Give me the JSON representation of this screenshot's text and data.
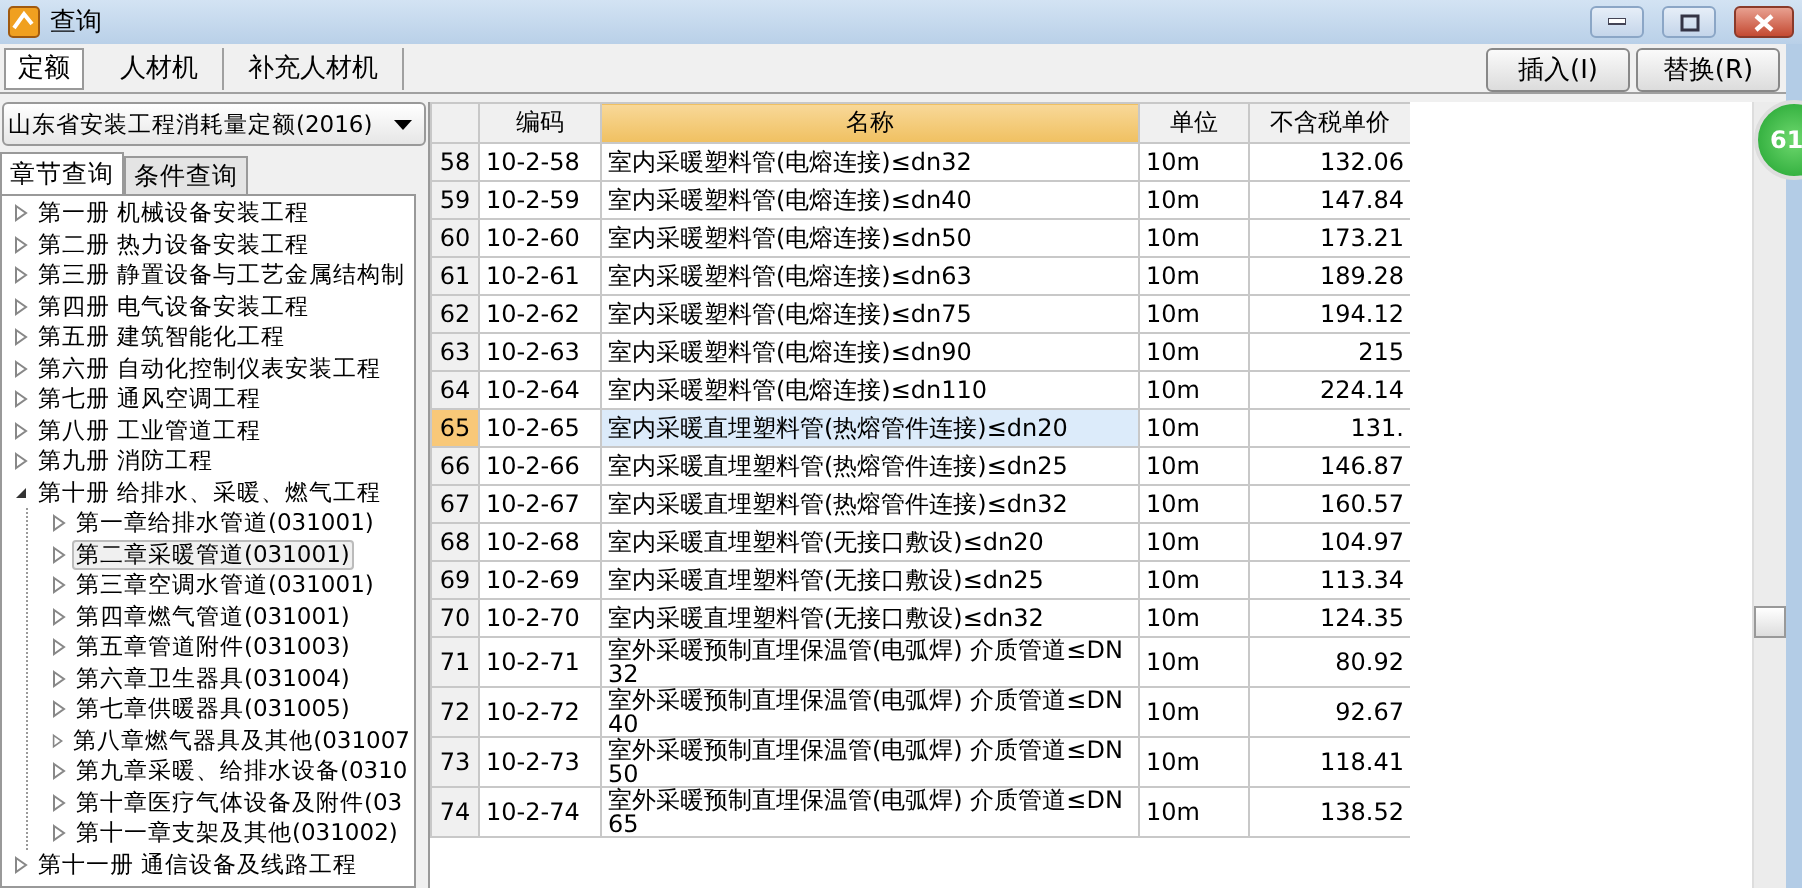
{
  "window": {
    "title": "查询"
  },
  "tabs": [
    {
      "label": "定额",
      "selected": true
    },
    {
      "label": "人材机",
      "selected": false
    },
    {
      "label": "补充人材机",
      "selected": false
    }
  ],
  "buttons": [
    "插入(I)",
    "替换(R)"
  ],
  "library_select": {
    "value": "山东省安装工程消耗量定额(2016)"
  },
  "search_tabs": [
    {
      "label": "章节查询",
      "selected": true
    },
    {
      "label": "条件查询",
      "selected": false
    }
  ],
  "tree": [
    {
      "label": "第一册 机械设备安装工程",
      "expanded": false,
      "selected": false
    },
    {
      "label": "第二册 热力设备安装工程",
      "expanded": false,
      "selected": false
    },
    {
      "label": "第三册 静置设备与工艺金属结构制",
      "expanded": false,
      "selected": false
    },
    {
      "label": "第四册 电气设备安装工程",
      "expanded": false,
      "selected": false
    },
    {
      "label": "第五册 建筑智能化工程",
      "expanded": false,
      "selected": false
    },
    {
      "label": "第六册 自动化控制仪表安装工程",
      "expanded": false,
      "selected": false
    },
    {
      "label": "第七册 通风空调工程",
      "expanded": false,
      "selected": false
    },
    {
      "label": "第八册 工业管道工程",
      "expanded": false,
      "selected": false
    },
    {
      "label": "第九册 消防工程",
      "expanded": false,
      "selected": false
    },
    {
      "label": "第十册 给排水、采暖、燃气工程",
      "expanded": true,
      "selected": false,
      "children": [
        {
          "label": "第一章给排水管道(031001)",
          "expanded": false,
          "selected": false
        },
        {
          "label": "第二章采暖管道(031001)",
          "expanded": false,
          "selected": true
        },
        {
          "label": "第三章空调水管道(031001)",
          "expanded": false,
          "selected": false
        },
        {
          "label": "第四章燃气管道(031001)",
          "expanded": false,
          "selected": false
        },
        {
          "label": "第五章管道附件(031003)",
          "expanded": false,
          "selected": false
        },
        {
          "label": "第六章卫生器具(031004)",
          "expanded": false,
          "selected": false
        },
        {
          "label": "第七章供暖器具(031005)",
          "expanded": false,
          "selected": false
        },
        {
          "label": "第八章燃气器具及其他(031007",
          "expanded": false,
          "selected": false
        },
        {
          "label": "第九章采暖、给排水设备(0310",
          "expanded": false,
          "selected": false
        },
        {
          "label": "第十章医疗气体设备及附件(03",
          "expanded": false,
          "selected": false
        },
        {
          "label": "第十一章支架及其他(031002)",
          "expanded": false,
          "selected": false
        }
      ]
    },
    {
      "label": "第十一册 通信设备及线路工程",
      "expanded": false,
      "selected": false
    }
  ],
  "table": {
    "columns": [
      {
        "label": "编码",
        "selected": false
      },
      {
        "label": "名称",
        "selected": true
      },
      {
        "label": "单位",
        "selected": false
      },
      {
        "label": "不含税单价",
        "selected": false
      }
    ],
    "rows": [
      {
        "number": "58",
        "code": "10-2-58",
        "name": "室内采暖塑料管(电熔连接)≤dn32",
        "unit": "10m",
        "price": "132.06",
        "selected": false
      },
      {
        "number": "59",
        "code": "10-2-59",
        "name": "室内采暖塑料管(电熔连接)≤dn40",
        "unit": "10m",
        "price": "147.84",
        "selected": false
      },
      {
        "number": "60",
        "code": "10-2-60",
        "name": "室内采暖塑料管(电熔连接)≤dn50",
        "unit": "10m",
        "price": "173.21",
        "selected": false
      },
      {
        "number": "61",
        "code": "10-2-61",
        "name": "室内采暖塑料管(电熔连接)≤dn63",
        "unit": "10m",
        "price": "189.28",
        "selected": false
      },
      {
        "number": "62",
        "code": "10-2-62",
        "name": "室内采暖塑料管(电熔连接)≤dn75",
        "unit": "10m",
        "price": "194.12",
        "selected": false
      },
      {
        "number": "63",
        "code": "10-2-63",
        "name": "室内采暖塑料管(电熔连接)≤dn90",
        "unit": "10m",
        "price": "215",
        "selected": false
      },
      {
        "number": "64",
        "code": "10-2-64",
        "name": "室内采暖塑料管(电熔连接)≤dn110",
        "unit": "10m",
        "price": "224.14",
        "selected": false
      },
      {
        "number": "65",
        "code": "10-2-65",
        "name": "室内采暖直埋塑料管(热熔管件连接)≤dn20",
        "unit": "10m",
        "price": "131.",
        "selected": true
      },
      {
        "number": "66",
        "code": "10-2-66",
        "name": "室内采暖直埋塑料管(热熔管件连接)≤dn25",
        "unit": "10m",
        "price": "146.87",
        "selected": false
      },
      {
        "number": "67",
        "code": "10-2-67",
        "name": "室内采暖直埋塑料管(热熔管件连接)≤dn32",
        "unit": "10m",
        "price": "160.57",
        "selected": false
      },
      {
        "number": "68",
        "code": "10-2-68",
        "name": "室内采暖直埋塑料管(无接口敷设)≤dn20",
        "unit": "10m",
        "price": "104.97",
        "selected": false
      },
      {
        "number": "69",
        "code": "10-2-69",
        "name": "室内采暖直埋塑料管(无接口敷设)≤dn25",
        "unit": "10m",
        "price": "113.34",
        "selected": false
      },
      {
        "number": "70",
        "code": "10-2-70",
        "name": "室内采暖直埋塑料管(无接口敷设)≤dn32",
        "unit": "10m",
        "price": "124.35",
        "selected": false
      },
      {
        "number": "71",
        "code": "10-2-71",
        "name": "室外采暖预制直埋保温管(电弧焊) 介质管道≤DN32",
        "unit": "10m",
        "price": "80.92",
        "selected": false
      },
      {
        "number": "72",
        "code": "10-2-72",
        "name": "室外采暖预制直埋保温管(电弧焊) 介质管道≤DN40",
        "unit": "10m",
        "price": "92.67",
        "selected": false
      },
      {
        "number": "73",
        "code": "10-2-73",
        "name": "室外采暖预制直埋保温管(电弧焊) 介质管道≤DN50",
        "unit": "10m",
        "price": "118.41",
        "selected": false
      },
      {
        "number": "74",
        "code": "10-2-74",
        "name": "室外采暖预制直埋保温管(电弧焊) 介质管道≤DN65",
        "unit": "10m",
        "price": "138.52",
        "selected": false
      }
    ]
  },
  "badge": "61"
}
